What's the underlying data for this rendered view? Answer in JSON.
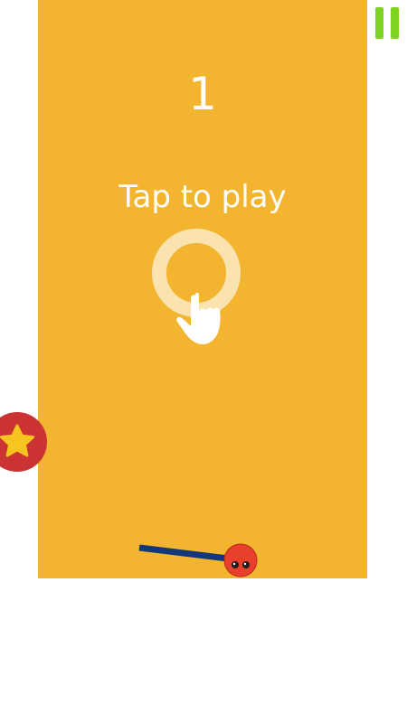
{
  "game": {
    "score": "1",
    "prompt": "Tap to play"
  },
  "icons": {
    "pause": "pause-icon",
    "star": "star-icon",
    "tap_hint": "hand-pointer-icon",
    "tap_ring": "ring-icon",
    "player": "red-ball-with-pole"
  },
  "colors": {
    "background": "#f3b42f",
    "page": "#ffffff",
    "pause": "#7ed321",
    "star_badge": "#cc3333",
    "star": "#f7c51f",
    "player_ball": "#e8402b",
    "pole": "#12387a",
    "text": "#ffffff"
  }
}
